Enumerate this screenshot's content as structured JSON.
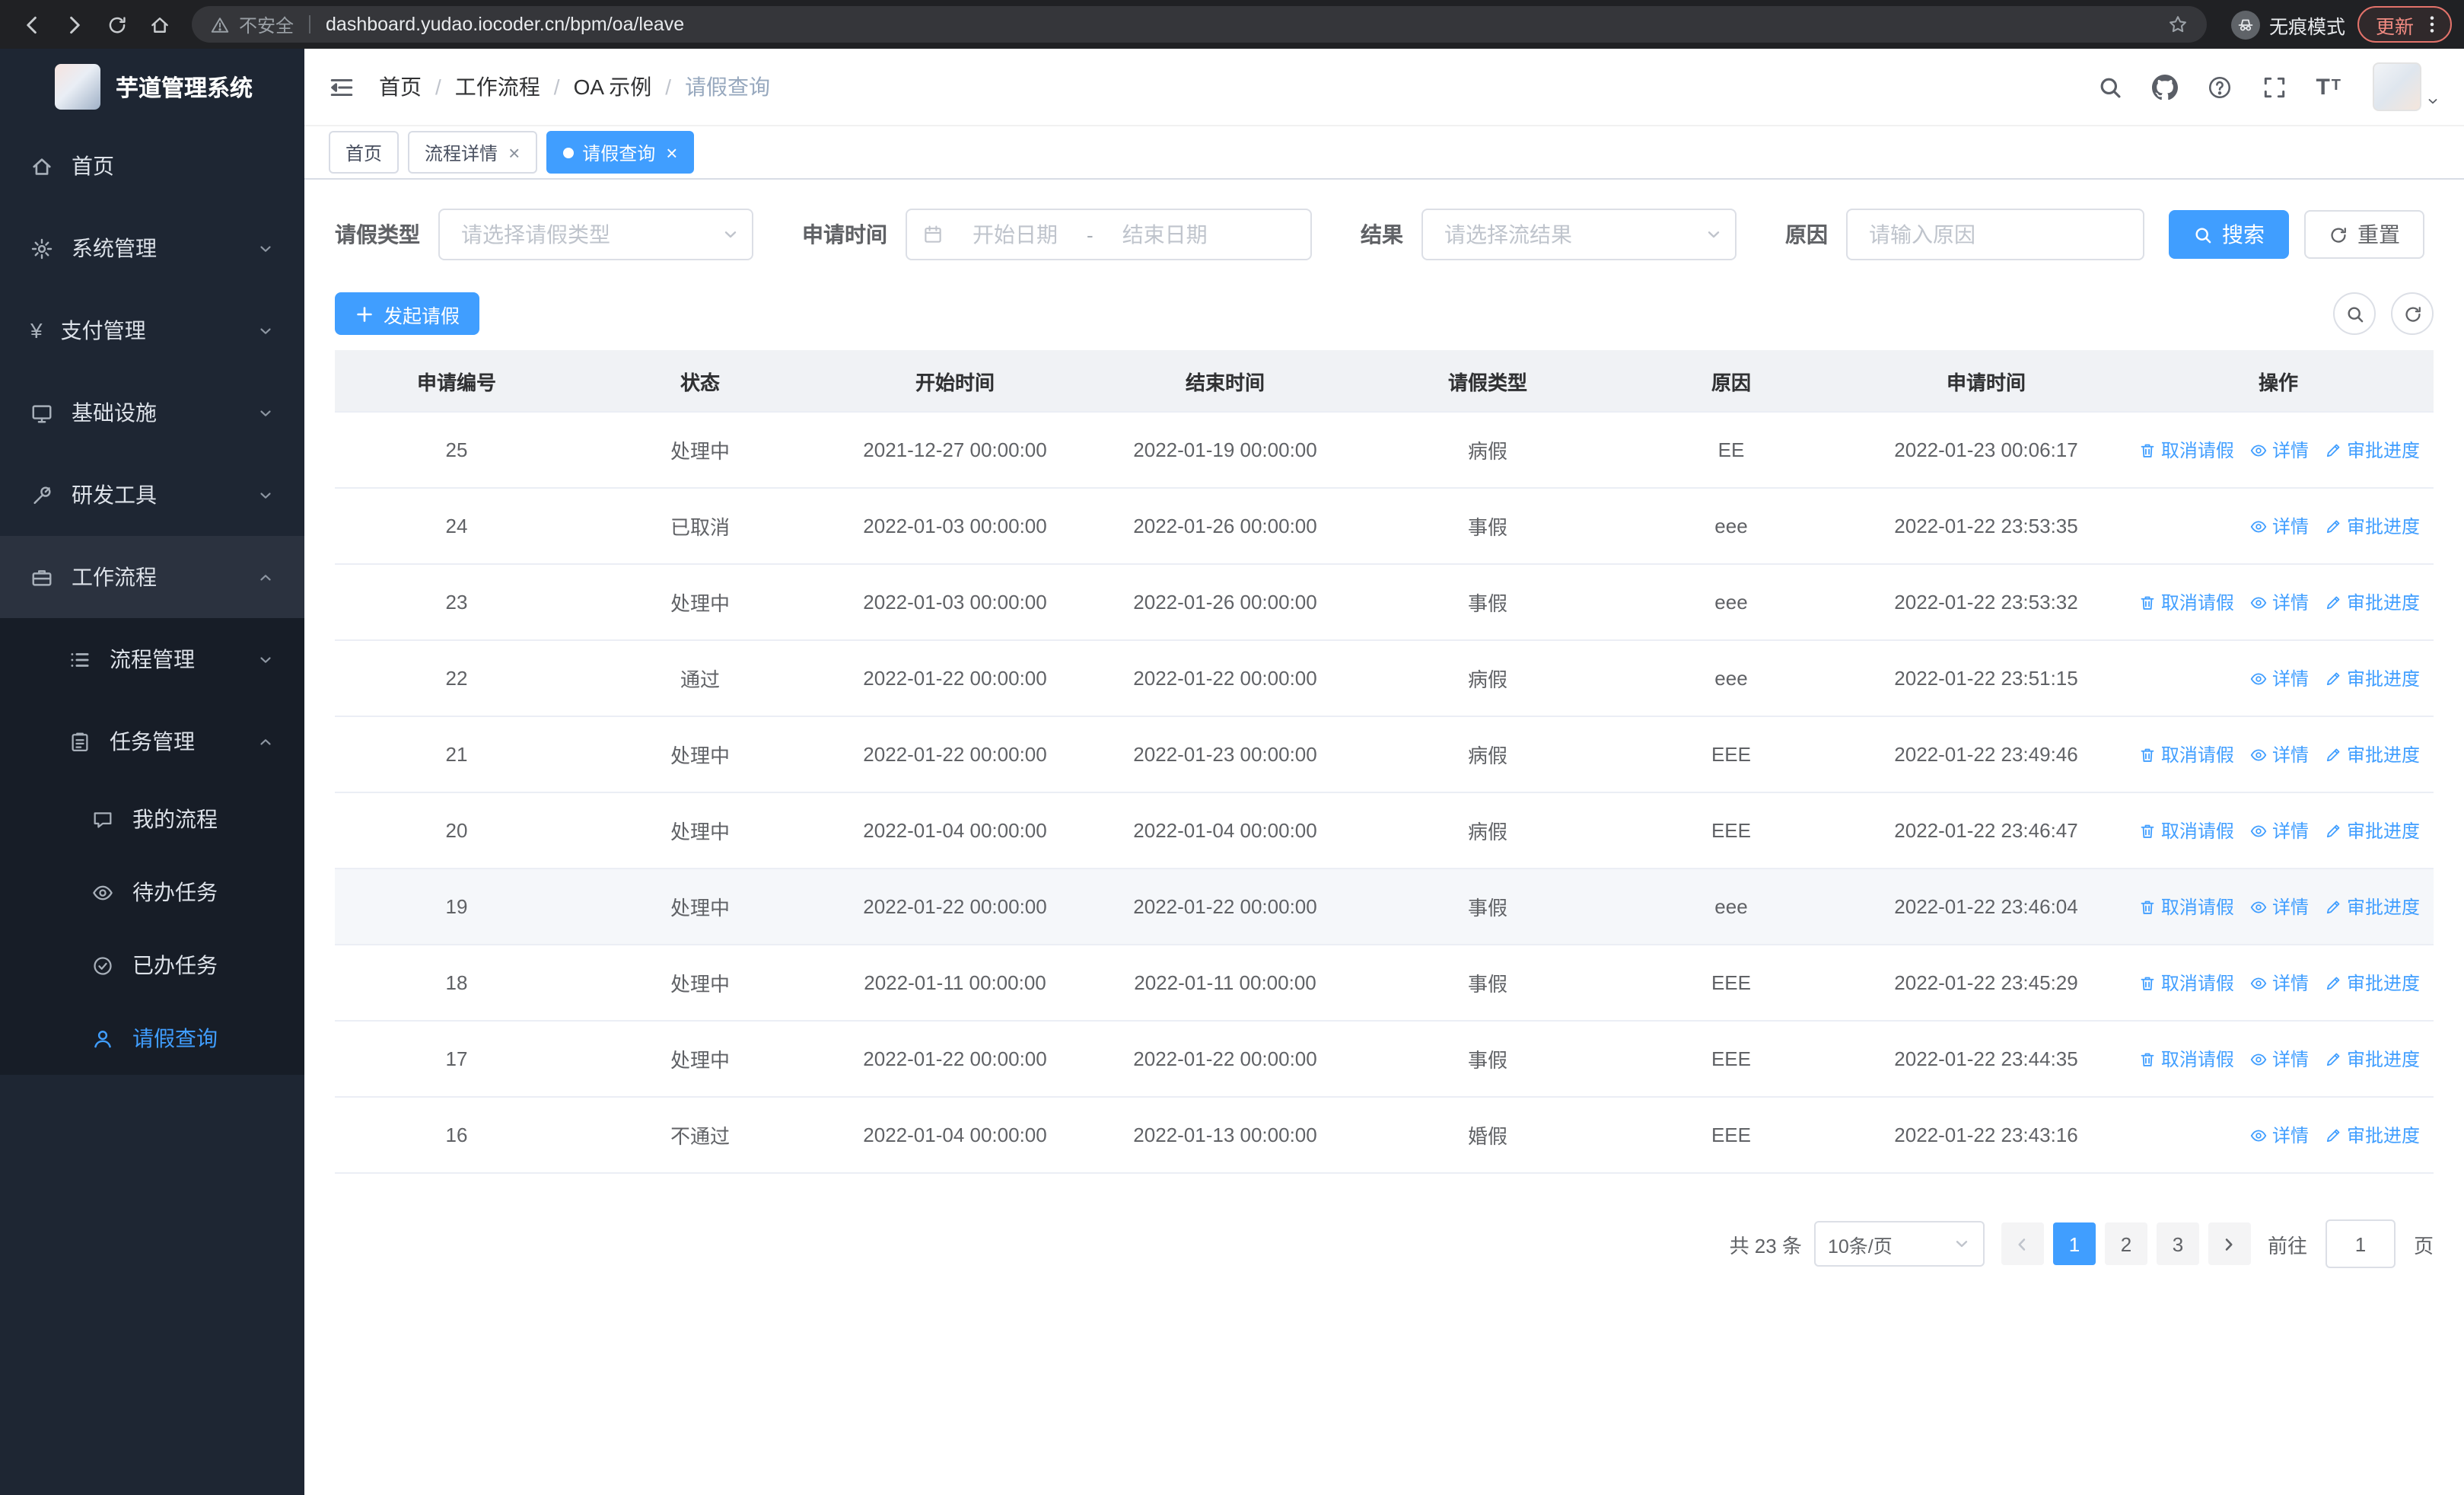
{
  "browser": {
    "nav_icons": [
      "back",
      "forward",
      "refresh",
      "home"
    ],
    "security_label": "不安全",
    "url": "dashboard.yudao.iocoder.cn/bpm/oa/leave",
    "incognito_label": "无痕模式",
    "update_label": "更新"
  },
  "sidebar": {
    "app_title": "芋道管理系统",
    "menu": [
      {
        "key": "home",
        "label": "首页",
        "icon": "home",
        "level": 1
      },
      {
        "key": "system",
        "label": "系统管理",
        "icon": "gear",
        "level": 1,
        "chevron": "down"
      },
      {
        "key": "payment",
        "label": "支付管理",
        "icon": "yen",
        "level": 1,
        "chevron": "down"
      },
      {
        "key": "infrastructure",
        "label": "基础设施",
        "icon": "monitor",
        "level": 1,
        "chevron": "down"
      },
      {
        "key": "devtools",
        "label": "研发工具",
        "icon": "tool",
        "level": 1,
        "chevron": "down"
      },
      {
        "key": "workflow",
        "label": "工作流程",
        "icon": "briefcase",
        "level": 1,
        "chevron": "up",
        "open": true
      },
      {
        "key": "process-mgmt",
        "label": "流程管理",
        "icon": "list",
        "level": 2,
        "chevron": "down"
      },
      {
        "key": "task-mgmt",
        "label": "任务管理",
        "icon": "tasks",
        "level": 2,
        "chevron": "up"
      },
      {
        "key": "my-process",
        "label": "我的流程",
        "icon": "chat",
        "level": 3
      },
      {
        "key": "todo-tasks",
        "label": "待办任务",
        "icon": "eye",
        "level": 3
      },
      {
        "key": "done-tasks",
        "label": "已办任务",
        "icon": "check-circle",
        "level": 3
      },
      {
        "key": "leave-query",
        "label": "请假查询",
        "icon": "user",
        "level": 3,
        "active": true
      }
    ]
  },
  "header": {
    "breadcrumb_separator": "/",
    "breadcrumb": [
      {
        "label": "首页"
      },
      {
        "label": "工作流程"
      },
      {
        "label": "OA 示例"
      },
      {
        "label": "请假查询",
        "current": true
      }
    ],
    "icons": [
      "search",
      "github",
      "question",
      "fullscreen",
      "font-size"
    ]
  },
  "tabs": [
    {
      "key": "home",
      "label": "首页",
      "closable": false,
      "active": false
    },
    {
      "key": "process-detail",
      "label": "流程详情",
      "closable": true,
      "active": false
    },
    {
      "key": "leave-query",
      "label": "请假查询",
      "closable": true,
      "active": true
    }
  ],
  "filters": {
    "leave_type_label": "请假类型",
    "leave_type_placeholder": "请选择请假类型",
    "apply_time_label": "申请时间",
    "start_date_placeholder": "开始日期",
    "range_separator": "-",
    "end_date_placeholder": "结束日期",
    "result_label": "结果",
    "result_placeholder": "请选择流结果",
    "reason_label": "原因",
    "reason_placeholder": "请输入原因",
    "search_label": "搜索",
    "reset_label": "重置"
  },
  "toolbar": {
    "create_label": "发起请假"
  },
  "table": {
    "columns": [
      "申请编号",
      "状态",
      "开始时间",
      "结束时间",
      "请假类型",
      "原因",
      "申请时间",
      "操作"
    ],
    "actions": {
      "cancel": "取消请假",
      "detail": "详情",
      "progress": "审批进度"
    },
    "action_icons": {
      "cancel": "trash",
      "detail": "eye",
      "progress": "pen"
    },
    "rows": [
      {
        "id": "25",
        "status": "处理中",
        "start": "2021-12-27 00:00:00",
        "end": "2022-01-19 00:00:00",
        "type": "病假",
        "reason": "EE",
        "apply_time": "2022-01-23 00:06:17",
        "can_cancel": true
      },
      {
        "id": "24",
        "status": "已取消",
        "start": "2022-01-03 00:00:00",
        "end": "2022-01-26 00:00:00",
        "type": "事假",
        "reason": "eee",
        "apply_time": "2022-01-22 23:53:35",
        "can_cancel": false
      },
      {
        "id": "23",
        "status": "处理中",
        "start": "2022-01-03 00:00:00",
        "end": "2022-01-26 00:00:00",
        "type": "事假",
        "reason": "eee",
        "apply_time": "2022-01-22 23:53:32",
        "can_cancel": true
      },
      {
        "id": "22",
        "status": "通过",
        "start": "2022-01-22 00:00:00",
        "end": "2022-01-22 00:00:00",
        "type": "病假",
        "reason": "eee",
        "apply_time": "2022-01-22 23:51:15",
        "can_cancel": false
      },
      {
        "id": "21",
        "status": "处理中",
        "start": "2022-01-22 00:00:00",
        "end": "2022-01-23 00:00:00",
        "type": "病假",
        "reason": "EEE",
        "apply_time": "2022-01-22 23:49:46",
        "can_cancel": true
      },
      {
        "id": "20",
        "status": "处理中",
        "start": "2022-01-04 00:00:00",
        "end": "2022-01-04 00:00:00",
        "type": "病假",
        "reason": "EEE",
        "apply_time": "2022-01-22 23:46:47",
        "can_cancel": true
      },
      {
        "id": "19",
        "status": "处理中",
        "start": "2022-01-22 00:00:00",
        "end": "2022-01-22 00:00:00",
        "type": "事假",
        "reason": "eee",
        "apply_time": "2022-01-22 23:46:04",
        "can_cancel": true,
        "highlight": true
      },
      {
        "id": "18",
        "status": "处理中",
        "start": "2022-01-11 00:00:00",
        "end": "2022-01-11 00:00:00",
        "type": "事假",
        "reason": "EEE",
        "apply_time": "2022-01-22 23:45:29",
        "can_cancel": true
      },
      {
        "id": "17",
        "status": "处理中",
        "start": "2022-01-22 00:00:00",
        "end": "2022-01-22 00:00:00",
        "type": "事假",
        "reason": "EEE",
        "apply_time": "2022-01-22 23:44:35",
        "can_cancel": true
      },
      {
        "id": "16",
        "status": "不通过",
        "start": "2022-01-04 00:00:00",
        "end": "2022-01-13 00:00:00",
        "type": "婚假",
        "reason": "EEE",
        "apply_time": "2022-01-22 23:43:16",
        "can_cancel": false
      }
    ]
  },
  "pagination": {
    "total_label": "共 23 条",
    "page_size_label": "10条/页",
    "pages": [
      "1",
      "2",
      "3"
    ],
    "current_page": "1",
    "goto_label": "前往",
    "goto_value": "1",
    "page_unit": "页"
  },
  "colors": {
    "primary": "#409eff",
    "chrome_bg": "#202124",
    "sidebar_bg": "#1e2633"
  }
}
